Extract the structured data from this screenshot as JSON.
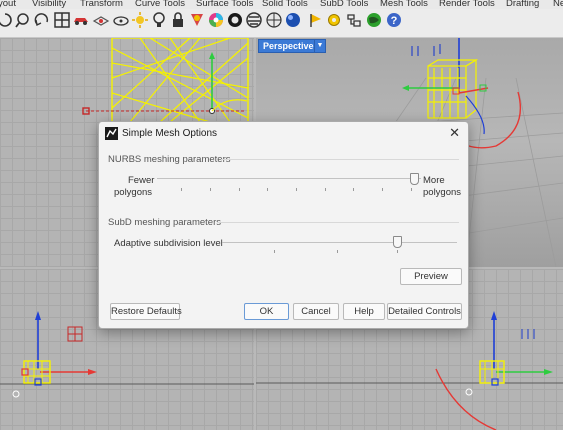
{
  "tabs": [
    "yout",
    "Visibility",
    "Transform",
    "Curve Tools",
    "Surface Tools",
    "Solid Tools",
    "SubD Tools",
    "Mesh Tools",
    "Render Tools",
    "Drafting",
    "Ne"
  ],
  "toolbar_icons": [
    "undo-icon",
    "pan-icon",
    "rotate-view-icon",
    "four-viewports-icon",
    "car-icon",
    "gumball-icon",
    "plane-icon",
    "sun-icon",
    "lightbulb-icon",
    "lock-icon",
    "materials-icon",
    "color-wheel-icon",
    "render-sphere-icon",
    "zebra-icon",
    "environment-icon",
    "sphere-icon",
    "flag-icon",
    "gear-icon",
    "layout-icon",
    "globe-icon",
    "help-icon"
  ],
  "viewports": {
    "perspective_label": "Perspective"
  },
  "dialog": {
    "title": "Simple Mesh Options",
    "close_glyph": "✕",
    "nurbs_section": "NURBS meshing parameters",
    "fewer_label_1": "Fewer",
    "fewer_label_2": "polygons",
    "more_label_1": "More",
    "more_label_2": "polygons",
    "nurbs_slider_value": 0.97,
    "subd_section": "SubD meshing parameters",
    "adaptive_label": "Adaptive subdivision level",
    "subd_slider_value": 0.74,
    "preview_button": "Preview",
    "restore_button": "Restore Defaults",
    "ok_button": "OK",
    "cancel_button": "Cancel",
    "help_button": "Help",
    "detailed_button": "Detailed Controls"
  },
  "colors": {
    "accent": "#3b7ad6",
    "axis_red": "#e53935",
    "axis_green": "#2ecc40",
    "axis_blue": "#1f3fd6",
    "selection_yellow": "#f5f200"
  }
}
